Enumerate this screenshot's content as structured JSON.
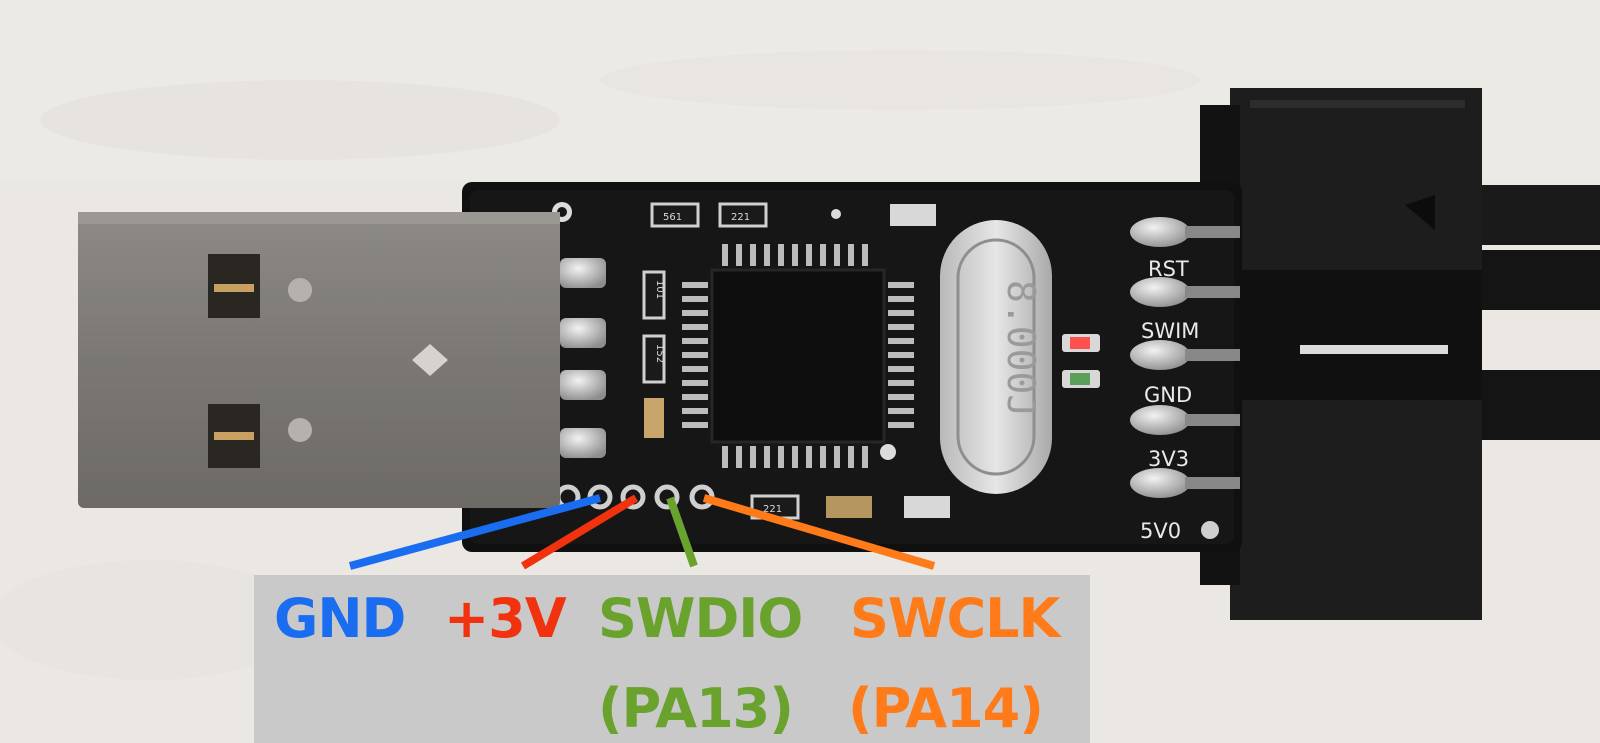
{
  "pcb_silkscreen": {
    "header_pins": [
      "RST",
      "SWIM",
      "GND",
      "3V3",
      "5V0"
    ],
    "resistor_marks": [
      "561",
      "221",
      "101",
      "152",
      "221"
    ],
    "crystal_marking": "8.000J"
  },
  "pin_labels": [
    {
      "name": "GND",
      "sub": "",
      "color": "#1a6cf0"
    },
    {
      "name": "+3V",
      "sub": "",
      "color": "#f0320f"
    },
    {
      "name": "SWDIO",
      "sub": "(PA13)",
      "color": "#6aa22e"
    },
    {
      "name": "SWCLK",
      "sub": "(PA14)",
      "color": "#ff7a18"
    }
  ],
  "colors": {
    "gnd": "#1a6cf0",
    "power": "#f0320f",
    "swdio": "#6aa22e",
    "swclk": "#ff7a18",
    "label_panel": "#c9c9c9"
  }
}
